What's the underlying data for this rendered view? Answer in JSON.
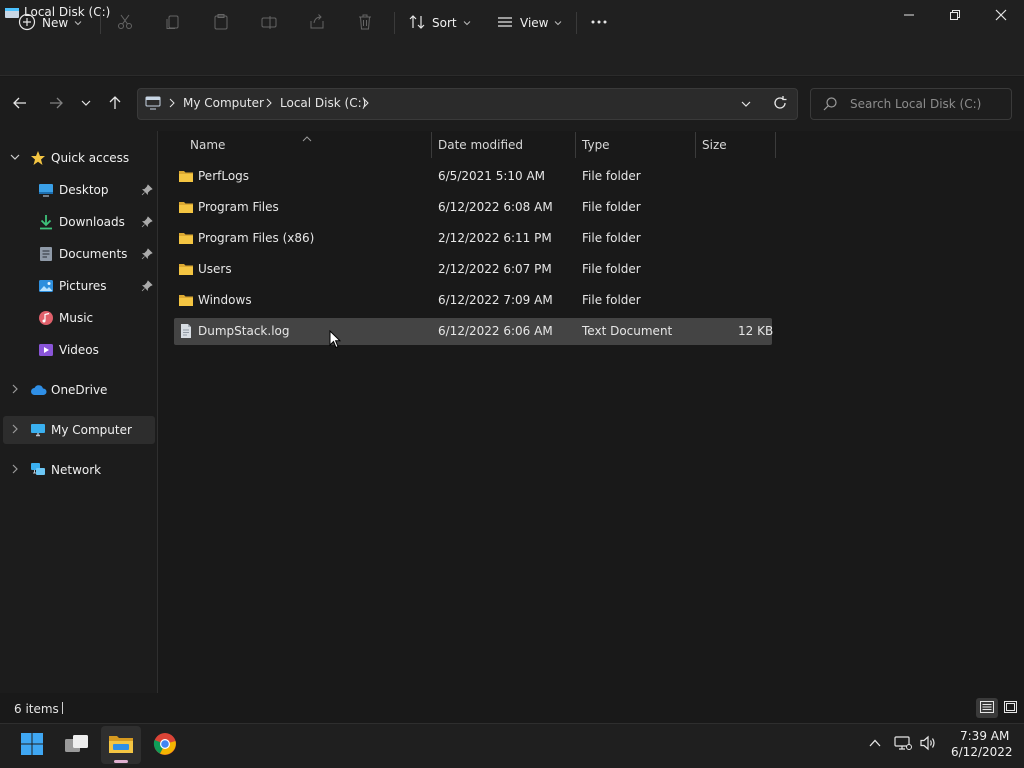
{
  "window": {
    "title": "Local Disk (C:)"
  },
  "commandbar": {
    "new_label": "New",
    "sort_label": "Sort",
    "view_label": "View"
  },
  "address": {
    "crumbs": [
      "My Computer",
      "Local Disk (C:)"
    ]
  },
  "search": {
    "placeholder": "Search Local Disk (C:)"
  },
  "sidebar": {
    "quick_access": "Quick access",
    "items": [
      {
        "label": "Desktop",
        "icon": "desktop-icon",
        "pinned": true
      },
      {
        "label": "Downloads",
        "icon": "downloads-icon",
        "pinned": true
      },
      {
        "label": "Documents",
        "icon": "documents-icon",
        "pinned": true
      },
      {
        "label": "Pictures",
        "icon": "pictures-icon",
        "pinned": true
      },
      {
        "label": "Music",
        "icon": "music-icon",
        "pinned": false
      },
      {
        "label": "Videos",
        "icon": "videos-icon",
        "pinned": false
      }
    ],
    "onedrive": "OneDrive",
    "my_computer": "My Computer",
    "network": "Network"
  },
  "table": {
    "columns": [
      "Name",
      "Date modified",
      "Type",
      "Size"
    ],
    "rows": [
      {
        "name": "PerfLogs",
        "date": "6/5/2021 5:10 AM",
        "type": "File folder",
        "size": "",
        "icon": "folder-icon"
      },
      {
        "name": "Program Files",
        "date": "6/12/2022 6:08 AM",
        "type": "File folder",
        "size": "",
        "icon": "folder-icon"
      },
      {
        "name": "Program Files (x86)",
        "date": "2/12/2022 6:11 PM",
        "type": "File folder",
        "size": "",
        "icon": "folder-icon"
      },
      {
        "name": "Users",
        "date": "2/12/2022 6:07 PM",
        "type": "File folder",
        "size": "",
        "icon": "folder-icon"
      },
      {
        "name": "Windows",
        "date": "6/12/2022 7:09 AM",
        "type": "File folder",
        "size": "",
        "icon": "folder-icon"
      },
      {
        "name": "DumpStack.log",
        "date": "6/12/2022 6:06 AM",
        "type": "Text Document",
        "size": "12 KB",
        "icon": "text-file-icon"
      }
    ]
  },
  "status": {
    "items_count": "6 items"
  },
  "taskbar": {
    "time": "7:39 AM",
    "date": "6/12/2022"
  },
  "colors": {
    "folder": "#f4c542",
    "accent": "#4cc2ff",
    "selected_row": "#444444"
  }
}
